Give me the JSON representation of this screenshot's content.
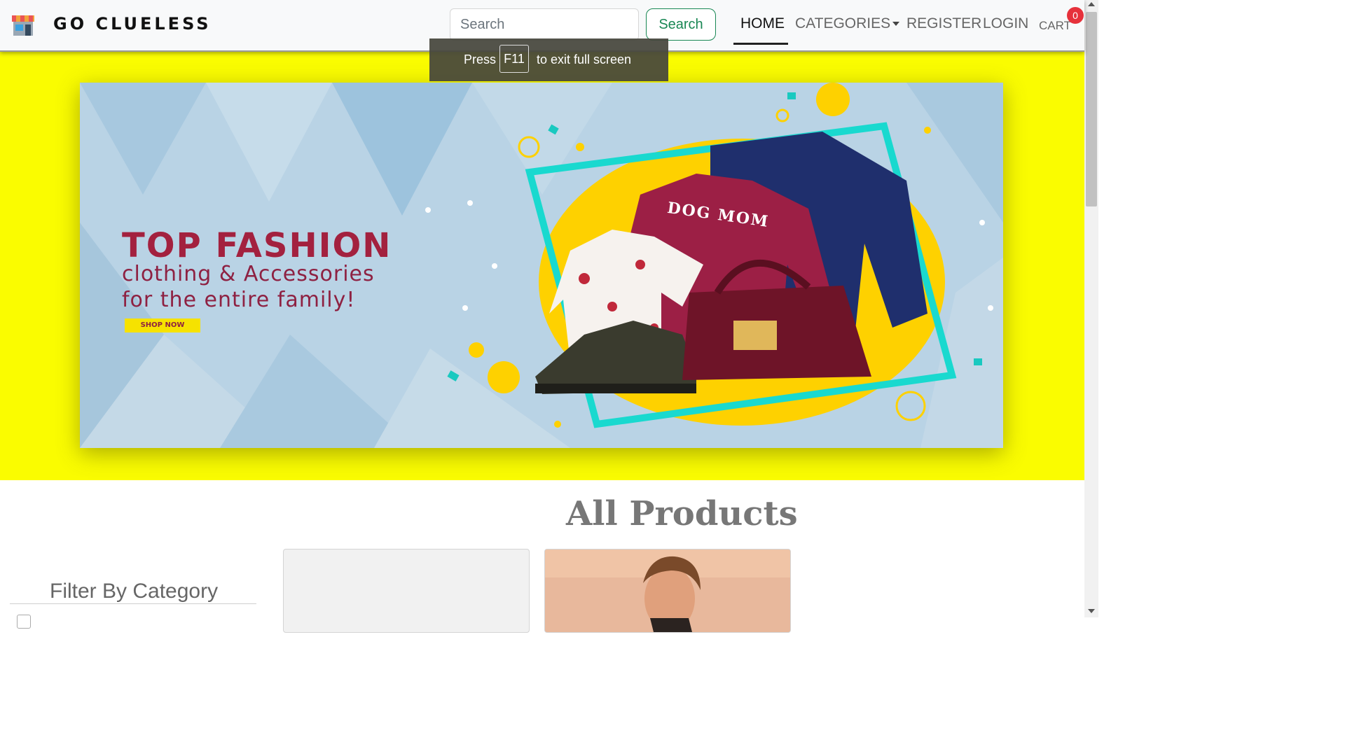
{
  "navbar": {
    "brand": "GO CLUELESS",
    "logo_icon": "storefront-icon",
    "search": {
      "placeholder": "Search",
      "value": "",
      "button_label": "Search"
    },
    "links": {
      "home": "HOME",
      "categories": "CATEGORIES",
      "register": "REGISTER",
      "login": "LOGIN",
      "cart": "CART"
    },
    "cart_count": "0",
    "active_link": "HOME"
  },
  "fullscreen_notice": {
    "before": "Press",
    "key": "F11",
    "after": "to exit full screen"
  },
  "hero": {
    "title": "TOP FASHION",
    "subtitle_line1": "clothing & Accessories",
    "subtitle_line2": "for the entire family!",
    "cta": "SHOP NOW",
    "sweater_text": "DOG MOM",
    "background_color": "#fafc00"
  },
  "products": {
    "heading": "All Products",
    "filter_title": "Filter By Category"
  },
  "colors": {
    "accent": "#198754",
    "badge": "#e6313b",
    "brand_maroon": "#a3213f"
  }
}
